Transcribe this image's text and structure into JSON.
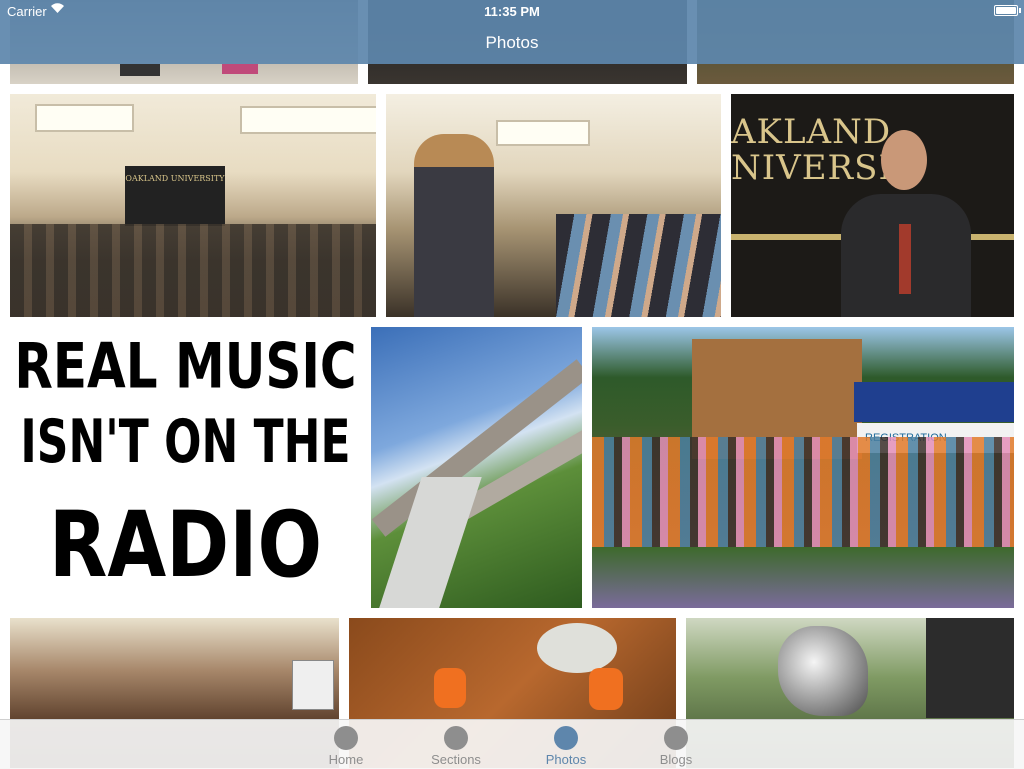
{
  "status_bar": {
    "carrier": "Carrier",
    "time": "11:35 PM"
  },
  "nav": {
    "title": "Photos"
  },
  "photos": {
    "poster_lines": [
      "REAL MUSIC",
      "ISN'T ON THE",
      "RADIO"
    ],
    "oakland_sign": "OAKLAND UNIVERSITY",
    "podium_sign": "AKLAND NIVERSIT",
    "banner_text": "REGISTRATION"
  },
  "tabs": [
    {
      "label": "Home",
      "icon": "circle-icon"
    },
    {
      "label": "Sections",
      "icon": "circle-icon"
    },
    {
      "label": "Photos",
      "icon": "circle-icon",
      "active": true
    },
    {
      "label": "Blogs",
      "icon": "circle-icon"
    }
  ],
  "colors": {
    "accent": "#5e86ac",
    "inactive": "#8e8e8e"
  }
}
